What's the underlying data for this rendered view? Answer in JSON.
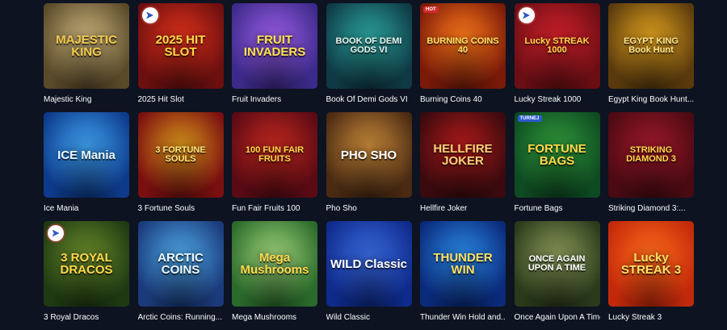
{
  "games": [
    {
      "title": "Majestic King",
      "logo": "MAJESTIC KING",
      "bg": "#5a4a2a",
      "bg2": "#c9b27a",
      "logo_color": "#f2c94c",
      "badge": "",
      "provider": false
    },
    {
      "title": "2025 Hit Slot",
      "logo": "2025 HIT SLOT",
      "bg": "#6b0f0f",
      "bg2": "#e0311a",
      "logo_color": "#ffd84a",
      "badge": "",
      "provider": true
    },
    {
      "title": "Fruit Invaders",
      "logo": "FRUIT INVADERS",
      "bg": "#3c2a8a",
      "bg2": "#9b5de5",
      "logo_color": "#ffe14d",
      "badge": "",
      "provider": false
    },
    {
      "title": "Book Of Demi Gods VI",
      "logo": "BOOK OF DEMI GODS VI",
      "bg": "#0f3a45",
      "bg2": "#2ba6a0",
      "logo_color": "#e8f4ef",
      "badge": "",
      "provider": false
    },
    {
      "title": "Burning Coins 40",
      "logo": "BURNING COINS 40",
      "bg": "#7a1a08",
      "bg2": "#ff7a1a",
      "logo_color": "#ffe066",
      "badge": "HOT",
      "provider": false
    },
    {
      "title": "Lucky Streak 1000",
      "logo": "Lucky STREAK 1000",
      "bg": "#6b0e14",
      "bg2": "#d1202a",
      "logo_color": "#ffd84a",
      "badge": "",
      "provider": true
    },
    {
      "title": "Egypt King Book Hunt...",
      "logo": "EGYPT KING Book Hunt",
      "bg": "#5a3a0c",
      "bg2": "#e0a21f",
      "logo_color": "#ffe28a",
      "badge": "",
      "provider": false
    },
    {
      "title": "Ice Mania",
      "logo": "ICE Mania",
      "bg": "#0d3a8a",
      "bg2": "#3fa2f0",
      "logo_color": "#e9f7ff",
      "badge": "",
      "provider": false
    },
    {
      "title": "3 Fortune Souls",
      "logo": "3 FORTUNE SOULS",
      "bg": "#7a0f0f",
      "bg2": "#d8961a",
      "logo_color": "#ffe27a",
      "badge": "",
      "provider": false
    },
    {
      "title": "Fun Fair Fruits 100",
      "logo": "100 FUN FAIR FRUITS",
      "bg": "#5a0a14",
      "bg2": "#c4281e",
      "logo_color": "#ffd84a",
      "badge": "",
      "provider": false
    },
    {
      "title": "Pho Sho",
      "logo": "PHO SHO",
      "bg": "#4a2a12",
      "bg2": "#c98a3a",
      "logo_color": "#ffffff",
      "badge": "",
      "provider": false
    },
    {
      "title": "Hellfire Joker",
      "logo": "HELLFIRE JOKER",
      "bg": "#3a0a0e",
      "bg2": "#b41a1a",
      "logo_color": "#ffd07a",
      "badge": "",
      "provider": false
    },
    {
      "title": "Fortune Bags",
      "logo": "FORTUNE BAGS",
      "bg": "#0e4a22",
      "bg2": "#2f9a3a",
      "logo_color": "#ffd84a",
      "badge": "TURNEJ",
      "provider": false
    },
    {
      "title": "Striking Diamond 3:...",
      "logo": "STRIKING DIAMOND 3",
      "bg": "#4a0a12",
      "bg2": "#a0182a",
      "logo_color": "#ffd84a",
      "badge": "",
      "provider": false
    },
    {
      "title": "3 Royal Dracos",
      "logo": "3 ROYAL DRACOS",
      "bg": "#1f3a12",
      "bg2": "#6a8a2a",
      "logo_color": "#ffd84a",
      "badge": "",
      "provider": true
    },
    {
      "title": "Arctic Coins: Running...",
      "logo": "ARCTIC COINS",
      "bg": "#1a3a7a",
      "bg2": "#4ea8e8",
      "logo_color": "#e9f7ff",
      "badge": "",
      "provider": false
    },
    {
      "title": "Mega Mushrooms",
      "logo": "Mega Mushrooms",
      "bg": "#2a6a2a",
      "bg2": "#9fd27a",
      "logo_color": "#ffd84a",
      "badge": "",
      "provider": false
    },
    {
      "title": "Wild Classic",
      "logo": "WILD Classic",
      "bg": "#0e2a8a",
      "bg2": "#3a6ae0",
      "logo_color": "#ffffff",
      "badge": "",
      "provider": false
    },
    {
      "title": "Thunder Win Hold and...",
      "logo": "THUNDER WIN",
      "bg": "#0a2a7a",
      "bg2": "#2a8ae8",
      "logo_color": "#ffe066",
      "badge": "",
      "provider": false
    },
    {
      "title": "Once Again Upon A Time",
      "logo": "ONCE AGAIN UPON A TIME",
      "bg": "#2a3a1a",
      "bg2": "#8a9a5a",
      "logo_color": "#ffffff",
      "badge": "",
      "provider": false
    },
    {
      "title": "Lucky Streak 3",
      "logo": "Lucky STREAK 3",
      "bg": "#c2290a",
      "bg2": "#ff6a1a",
      "logo_color": "#ffe066",
      "badge": "",
      "provider": false
    }
  ]
}
